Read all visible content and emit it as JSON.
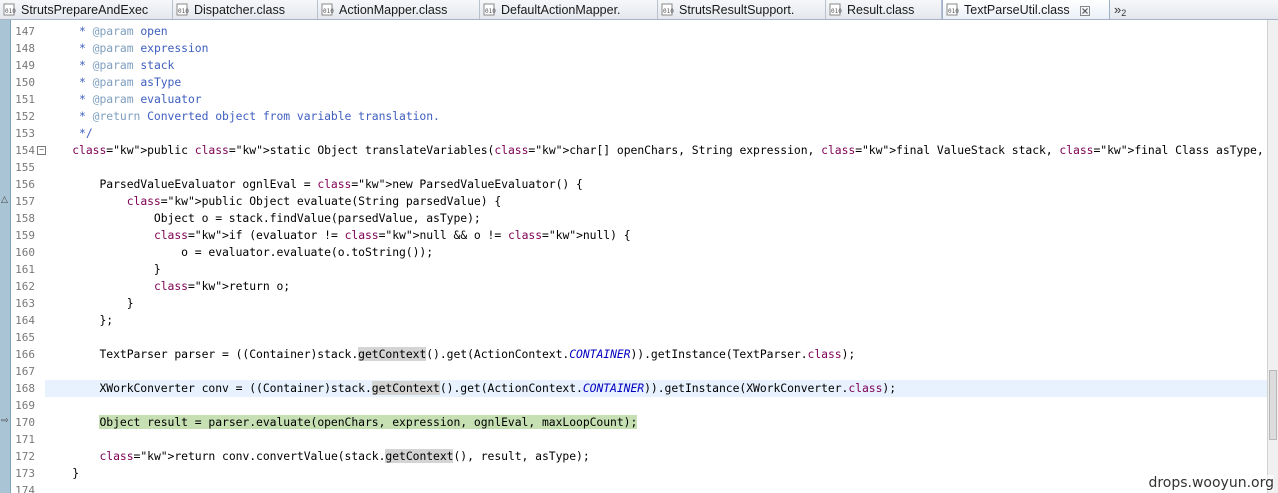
{
  "tabs": [
    {
      "label": "StrutsPrepareAndExec",
      "active": false
    },
    {
      "label": "Dispatcher.class",
      "active": false
    },
    {
      "label": "ActionMapper.class",
      "active": false
    },
    {
      "label": "DefaultActionMapper.",
      "active": false
    },
    {
      "label": "StrutsResultSupport.",
      "active": false
    },
    {
      "label": "Result.class",
      "active": false
    },
    {
      "label": "TextParseUtil.class",
      "active": true
    }
  ],
  "tab_overflow": {
    "chevron": "»",
    "count": "2"
  },
  "editor": {
    "current_line": "168",
    "breakpoint_highlight_line": "170",
    "lines": [
      {
        "n": "147",
        "text": "     * @param open"
      },
      {
        "n": "148",
        "text": "     * @param expression"
      },
      {
        "n": "149",
        "text": "     * @param stack"
      },
      {
        "n": "150",
        "text": "     * @param asType"
      },
      {
        "n": "151",
        "text": "     * @param evaluator"
      },
      {
        "n": "152",
        "text": "     * @return Converted object from variable translation."
      },
      {
        "n": "153",
        "text": "     */"
      },
      {
        "n": "154",
        "text": "    public static Object translateVariables(char[] openChars, String expression, final ValueStack stack, final Class asType, final ParsedValueEvaluator e"
      },
      {
        "n": "155",
        "text": ""
      },
      {
        "n": "156",
        "text": "        ParsedValueEvaluator ognlEval = new ParsedValueEvaluator() {"
      },
      {
        "n": "157",
        "text": "            public Object evaluate(String parsedValue) {"
      },
      {
        "n": "158",
        "text": "                Object o = stack.findValue(parsedValue, asType);"
      },
      {
        "n": "159",
        "text": "                if (evaluator != null && o != null) {"
      },
      {
        "n": "160",
        "text": "                    o = evaluator.evaluate(o.toString());"
      },
      {
        "n": "161",
        "text": "                }"
      },
      {
        "n": "162",
        "text": "                return o;"
      },
      {
        "n": "163",
        "text": "            }"
      },
      {
        "n": "164",
        "text": "        };"
      },
      {
        "n": "165",
        "text": ""
      },
      {
        "n": "166",
        "text": "        TextParser parser = ((Container)stack.getContext().get(ActionContext.CONTAINER)).getInstance(TextParser.class);"
      },
      {
        "n": "167",
        "text": ""
      },
      {
        "n": "168",
        "text": "        XWorkConverter conv = ((Container)stack.getContext().get(ActionContext.CONTAINER)).getInstance(XWorkConverter.class);"
      },
      {
        "n": "169",
        "text": ""
      },
      {
        "n": "170",
        "text": "        Object result = parser.evaluate(openChars, expression, ognlEval, maxLoopCount);"
      },
      {
        "n": "171",
        "text": ""
      },
      {
        "n": "172",
        "text": "        return conv.convertValue(stack.getContext(), result, asType);"
      },
      {
        "n": "173",
        "text": "    }"
      },
      {
        "n": "174",
        "text": ""
      }
    ]
  },
  "watermark": "drops.wooyun.org",
  "colors": {
    "keyword": "#7f0055",
    "javadoc": "#3f5fbf",
    "javadoc_tag": "#7f9fbf",
    "static_field": "#0000c0",
    "current_line": "#e8f2fe",
    "highlight": "#c6e0b4"
  }
}
